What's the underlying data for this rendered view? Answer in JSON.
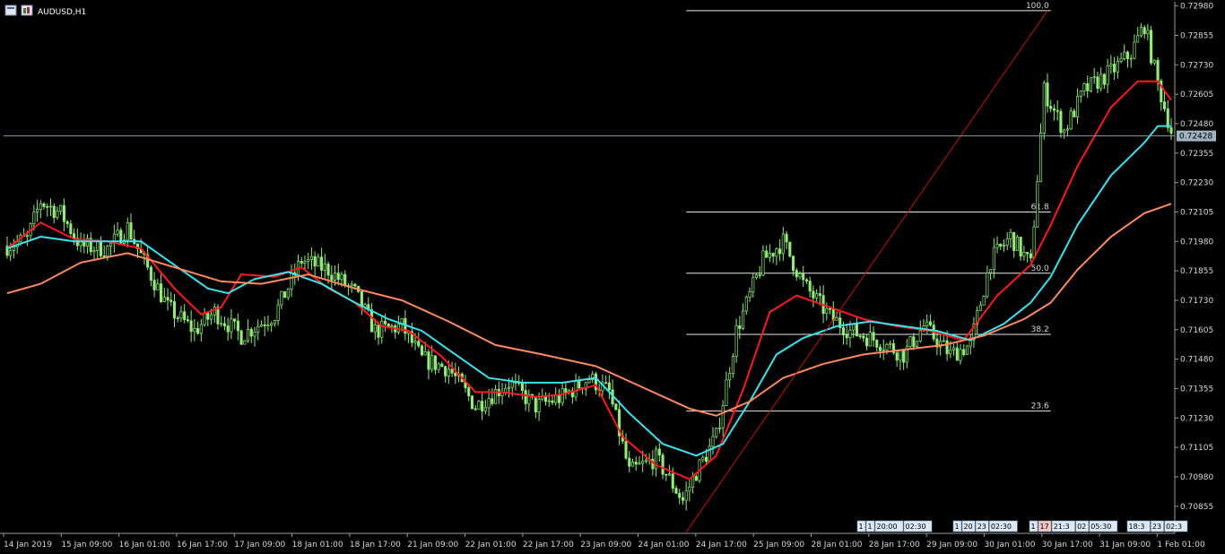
{
  "window": {
    "title": "AUDUSD,H1"
  },
  "colors": {
    "background": "#000000",
    "axis": "#9a9a9a",
    "candle": "#90ee78",
    "ma_fast": "#ff1a1a",
    "ma_mid": "#39e3f0",
    "ma_slow": "#ff8a5c",
    "fib": "#e8e8e8",
    "trend": "#cc1111",
    "bid_line": "#7fa0b8",
    "bid_label_bg": "#9fb2c0"
  },
  "chart_data": {
    "type": "candlestick",
    "symbol": "AUDUSD",
    "timeframe": "H1",
    "ylim": [
      0.7074,
      0.7299
    ],
    "y_ticks": [
      "0.72980",
      "0.72855",
      "0.72730",
      "0.72605",
      "0.72480",
      "0.72355",
      "0.72230",
      "0.72105",
      "0.71980",
      "0.71855",
      "0.71730",
      "0.71605",
      "0.71480",
      "0.71355",
      "0.71230",
      "0.71105",
      "0.70980",
      "0.70855"
    ],
    "x_ticks": [
      "14 Jan 2019",
      "15 Jan 09:00",
      "16 Jan 01:00",
      "16 Jan 17:00",
      "17 Jan 09:00",
      "18 Jan 01:00",
      "18 Jan 17:00",
      "21 Jan 09:00",
      "22 Jan 01:00",
      "22 Jan 17:00",
      "23 Jan 09:00",
      "24 Jan 01:00",
      "24 Jan 17:00",
      "25 Jan 09:00",
      "28 Jan 01:00",
      "28 Jan 17:00",
      "29 Jan 09:00",
      "30 Jan 01:00",
      "30 Jan 17:00",
      "31 Jan 09:00",
      "1 Feb 01:00"
    ],
    "current_price": "0.72428",
    "price_anchors": [
      [
        0,
        0.7196
      ],
      [
        6,
        0.7199
      ],
      [
        10,
        0.7215
      ],
      [
        16,
        0.721
      ],
      [
        22,
        0.7196
      ],
      [
        30,
        0.7195
      ],
      [
        36,
        0.7204
      ],
      [
        40,
        0.7192
      ],
      [
        48,
        0.717
      ],
      [
        56,
        0.716
      ],
      [
        62,
        0.7168
      ],
      [
        70,
        0.7158
      ],
      [
        80,
        0.7167
      ],
      [
        88,
        0.719
      ],
      [
        96,
        0.7186
      ],
      [
        104,
        0.7176
      ],
      [
        110,
        0.716
      ],
      [
        118,
        0.7162
      ],
      [
        124,
        0.7148
      ],
      [
        132,
        0.7144
      ],
      [
        140,
        0.7128
      ],
      [
        150,
        0.7138
      ],
      [
        158,
        0.7128
      ],
      [
        166,
        0.7132
      ],
      [
        174,
        0.714
      ],
      [
        180,
        0.7134
      ],
      [
        186,
        0.71
      ],
      [
        194,
        0.7106
      ],
      [
        202,
        0.7088
      ],
      [
        206,
        0.71
      ],
      [
        212,
        0.7115
      ],
      [
        218,
        0.716
      ],
      [
        226,
        0.719
      ],
      [
        232,
        0.7198
      ],
      [
        238,
        0.718
      ],
      [
        246,
        0.7166
      ],
      [
        252,
        0.716
      ],
      [
        260,
        0.7156
      ],
      [
        268,
        0.715
      ],
      [
        274,
        0.7162
      ],
      [
        282,
        0.715
      ],
      [
        288,
        0.7154
      ],
      [
        294,
        0.719
      ],
      [
        300,
        0.72
      ],
      [
        306,
        0.7188
      ],
      [
        310,
        0.7262
      ],
      [
        316,
        0.7245
      ],
      [
        322,
        0.7262
      ],
      [
        330,
        0.727
      ],
      [
        336,
        0.7278
      ],
      [
        340,
        0.729
      ],
      [
        344,
        0.7265
      ],
      [
        348,
        0.7245
      ]
    ],
    "candle_count": 349,
    "moving_averages": [
      {
        "color": "#ff1a1a",
        "points": [
          [
            0,
            0.7195
          ],
          [
            10,
            0.7206
          ],
          [
            20,
            0.7199
          ],
          [
            30,
            0.7198
          ],
          [
            40,
            0.7195
          ],
          [
            50,
            0.7178
          ],
          [
            58,
            0.7167
          ],
          [
            64,
            0.717
          ],
          [
            70,
            0.7184
          ],
          [
            80,
            0.7183
          ],
          [
            88,
            0.7187
          ],
          [
            96,
            0.7178
          ],
          [
            104,
            0.7172
          ],
          [
            112,
            0.7162
          ],
          [
            120,
            0.716
          ],
          [
            130,
            0.7149
          ],
          [
            140,
            0.7134
          ],
          [
            148,
            0.7134
          ],
          [
            158,
            0.7132
          ],
          [
            166,
            0.7133
          ],
          [
            176,
            0.7137
          ],
          [
            184,
            0.7115
          ],
          [
            194,
            0.7103
          ],
          [
            204,
            0.7097
          ],
          [
            212,
            0.7107
          ],
          [
            220,
            0.7135
          ],
          [
            228,
            0.7168
          ],
          [
            236,
            0.7175
          ],
          [
            246,
            0.717
          ],
          [
            256,
            0.7165
          ],
          [
            266,
            0.7162
          ],
          [
            276,
            0.716
          ],
          [
            286,
            0.7156
          ],
          [
            296,
            0.7175
          ],
          [
            306,
            0.7188
          ],
          [
            312,
            0.7205
          ],
          [
            320,
            0.723
          ],
          [
            330,
            0.7255
          ],
          [
            338,
            0.7266
          ],
          [
            344,
            0.7266
          ],
          [
            348,
            0.7258
          ]
        ]
      },
      {
        "color": "#39e3f0",
        "points": [
          [
            0,
            0.7195
          ],
          [
            10,
            0.72
          ],
          [
            20,
            0.7198
          ],
          [
            30,
            0.7198
          ],
          [
            40,
            0.7198
          ],
          [
            50,
            0.7188
          ],
          [
            60,
            0.7178
          ],
          [
            66,
            0.7176
          ],
          [
            74,
            0.7182
          ],
          [
            84,
            0.7185
          ],
          [
            94,
            0.718
          ],
          [
            104,
            0.7172
          ],
          [
            114,
            0.7165
          ],
          [
            124,
            0.716
          ],
          [
            134,
            0.715
          ],
          [
            144,
            0.714
          ],
          [
            154,
            0.7138
          ],
          [
            166,
            0.7138
          ],
          [
            176,
            0.714
          ],
          [
            186,
            0.7125
          ],
          [
            196,
            0.7112
          ],
          [
            206,
            0.7107
          ],
          [
            214,
            0.7112
          ],
          [
            222,
            0.713
          ],
          [
            230,
            0.715
          ],
          [
            238,
            0.7157
          ],
          [
            248,
            0.7162
          ],
          [
            258,
            0.7164
          ],
          [
            268,
            0.7162
          ],
          [
            278,
            0.716
          ],
          [
            288,
            0.7156
          ],
          [
            298,
            0.7163
          ],
          [
            306,
            0.7172
          ],
          [
            312,
            0.7183
          ],
          [
            320,
            0.7205
          ],
          [
            330,
            0.7226
          ],
          [
            340,
            0.724
          ],
          [
            344,
            0.7247
          ],
          [
            348,
            0.7247
          ]
        ]
      },
      {
        "color": "#ff8a5c",
        "points": [
          [
            0,
            0.7176
          ],
          [
            10,
            0.718
          ],
          [
            22,
            0.7189
          ],
          [
            36,
            0.7193
          ],
          [
            50,
            0.7187
          ],
          [
            64,
            0.7181
          ],
          [
            76,
            0.718
          ],
          [
            90,
            0.7184
          ],
          [
            104,
            0.7178
          ],
          [
            118,
            0.7173
          ],
          [
            132,
            0.7164
          ],
          [
            146,
            0.7154
          ],
          [
            160,
            0.715
          ],
          [
            176,
            0.7145
          ],
          [
            190,
            0.7136
          ],
          [
            204,
            0.7127
          ],
          [
            212,
            0.7124
          ],
          [
            222,
            0.713
          ],
          [
            232,
            0.714
          ],
          [
            244,
            0.7146
          ],
          [
            256,
            0.715
          ],
          [
            268,
            0.7152
          ],
          [
            280,
            0.7154
          ],
          [
            292,
            0.7158
          ],
          [
            304,
            0.7165
          ],
          [
            312,
            0.7172
          ],
          [
            320,
            0.7186
          ],
          [
            330,
            0.72
          ],
          [
            340,
            0.721
          ],
          [
            348,
            0.7214
          ]
        ]
      }
    ],
    "fibonacci": {
      "levels": [
        {
          "label": "100.0",
          "price": 0.7296
        },
        {
          "label": "61.8",
          "price": 0.72105
        },
        {
          "label": "50.0",
          "price": 0.71845
        },
        {
          "label": "38.2",
          "price": 0.71585
        },
        {
          "label": "23.6",
          "price": 0.7126
        }
      ],
      "start_index": 203,
      "end_index": 312,
      "trend_from": [
        203,
        0.70745
      ],
      "trend_to": [
        311,
        0.7296
      ]
    },
    "bottom_markers": [
      "1",
      "1",
      "20:00",
      "02:30",
      "1",
      "20",
      "23",
      "02:30",
      "1",
      "17",
      "21:3",
      "02",
      "05:30",
      "18:3",
      "23",
      "02:3"
    ]
  }
}
